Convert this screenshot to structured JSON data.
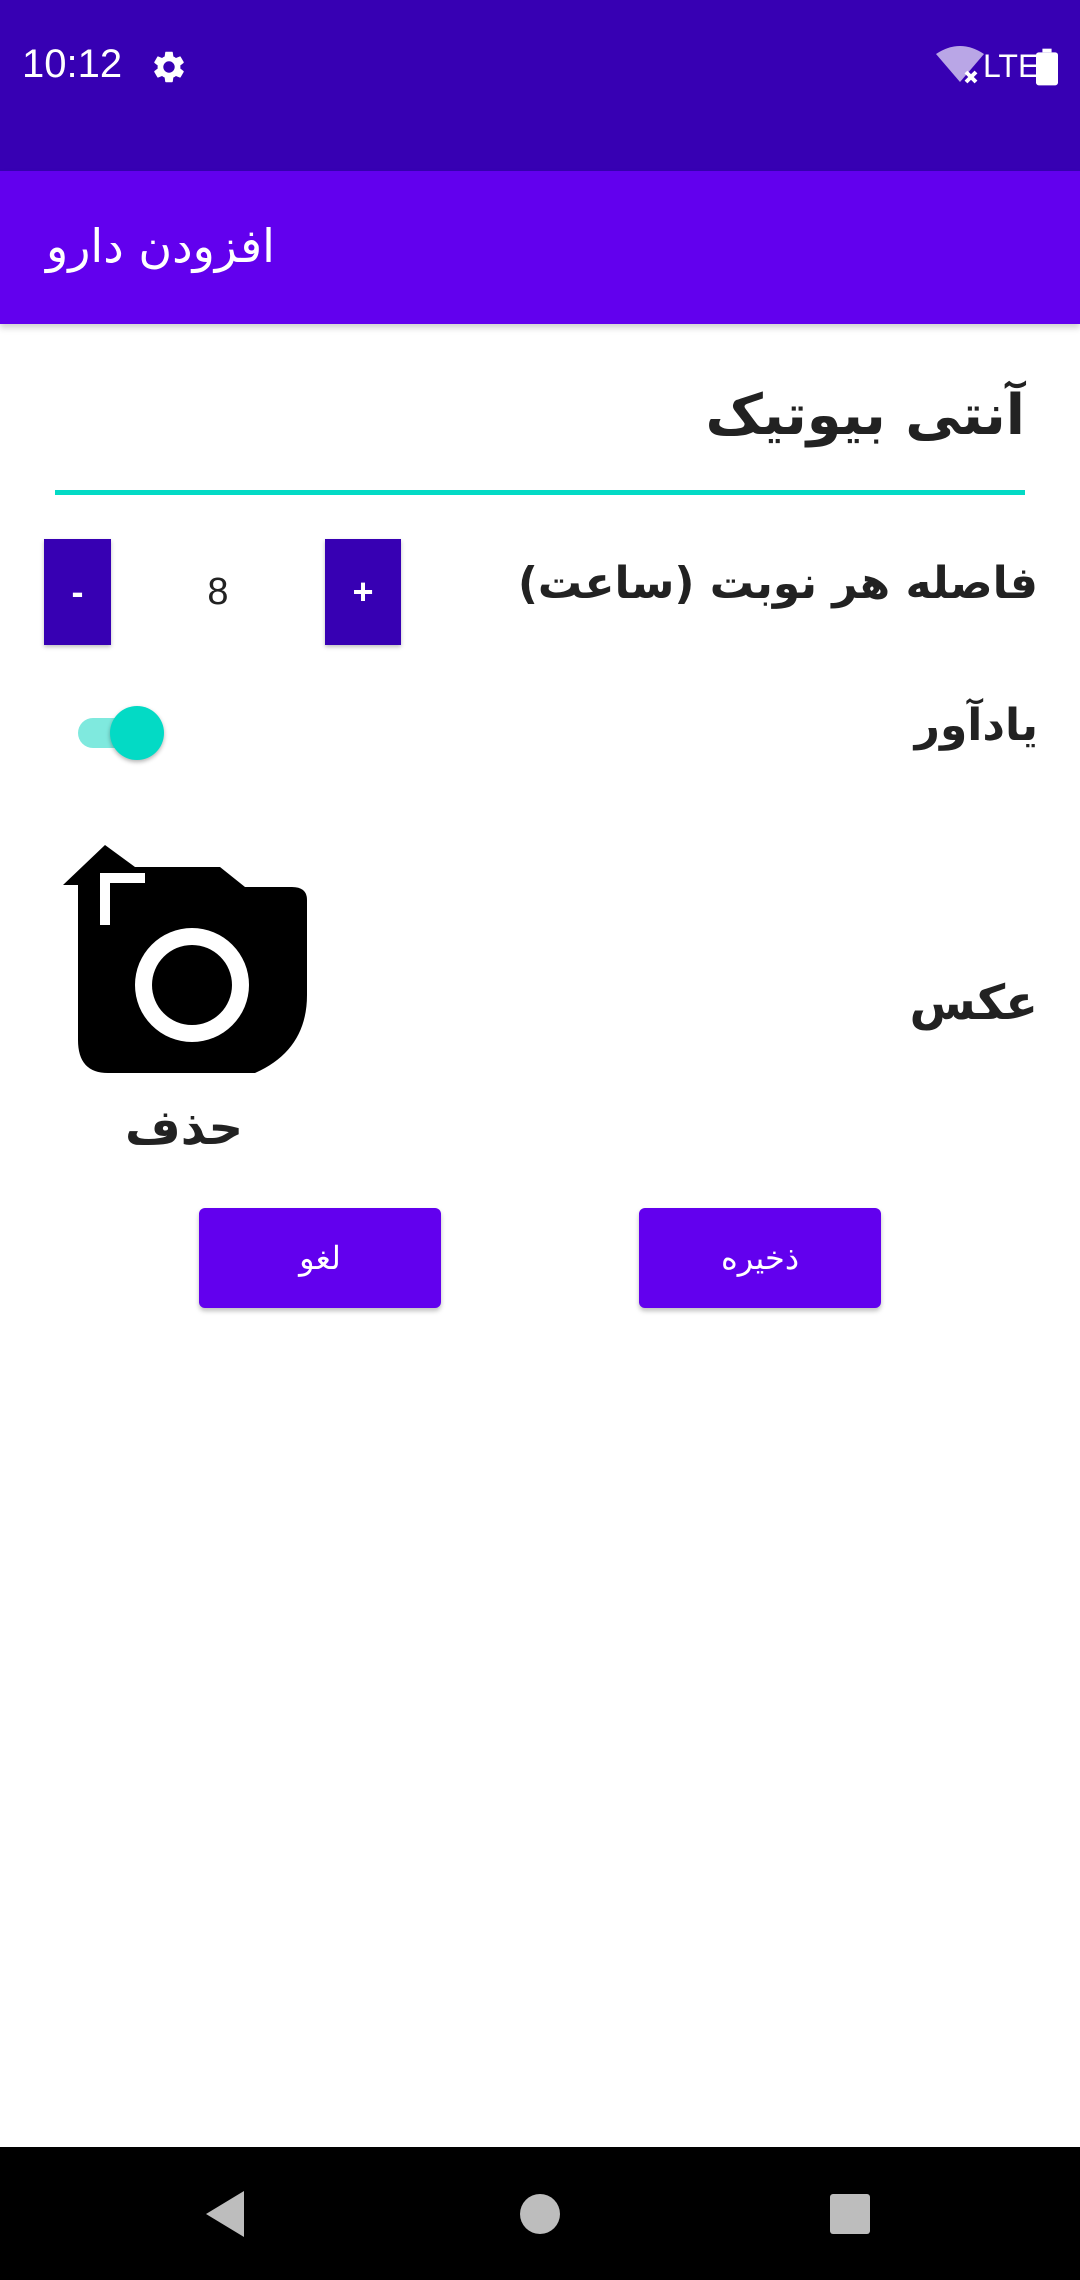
{
  "status_bar": {
    "time": "10:12",
    "network": "LTE",
    "icons": [
      "gear-icon",
      "wifi-off-icon",
      "battery-icon"
    ]
  },
  "app_bar": {
    "title": "افزودن دارو"
  },
  "form": {
    "medicine_name": "آنتی بیوتیک",
    "interval_label": "فاصله هر نوبت (ساعت)",
    "interval_value": "8",
    "minus_label": "-",
    "plus_label": "+",
    "reminder_label": "یادآور",
    "reminder_on": true,
    "photo_label": "عکس",
    "photo_icon": "add-a-photo-icon",
    "delete_label": "حذف"
  },
  "actions": {
    "save_label": "ذخیره",
    "cancel_label": "لغو"
  },
  "colors": {
    "status_bar": "#3700b3",
    "app_bar": "#6200ee",
    "accent": "#03dac5",
    "stepper": "#3700b3",
    "button": "#6200ee"
  }
}
